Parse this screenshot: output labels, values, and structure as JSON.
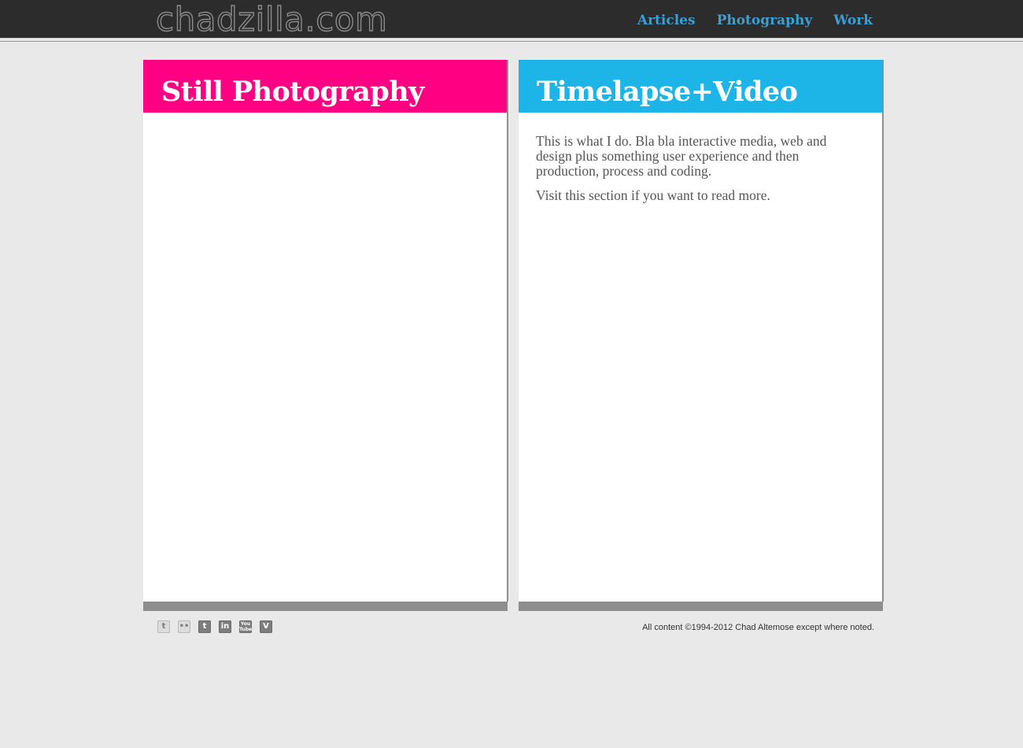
{
  "header": {
    "logo": "chadzilla.com",
    "nav": [
      {
        "label": "Articles"
      },
      {
        "label": "Photography"
      },
      {
        "label": "Work"
      }
    ]
  },
  "panels": {
    "left": {
      "title": "Still Photography",
      "accent_color": "#ff0082"
    },
    "right": {
      "title": "Timelapse+Video",
      "accent_color": "#1db5e8",
      "paragraphs": [
        "This is what I do. Bla bla interactive media, web and design plus something user experience and then production, process and coding.",
        "Visit this section if you want to read more."
      ]
    }
  },
  "footer": {
    "social": [
      {
        "icon": "twitter-icon",
        "glyph": "t"
      },
      {
        "icon": "flickr-icon",
        "glyph": "••"
      },
      {
        "icon": "tumblr-icon",
        "glyph": "t"
      },
      {
        "icon": "linkedin-icon",
        "glyph": "in"
      },
      {
        "icon": "youtube-icon",
        "glyph": "You Tube"
      },
      {
        "icon": "vimeo-icon",
        "glyph": "V"
      }
    ],
    "copyright": "All content ©1994-2012 Chad Altemose except where noted."
  }
}
